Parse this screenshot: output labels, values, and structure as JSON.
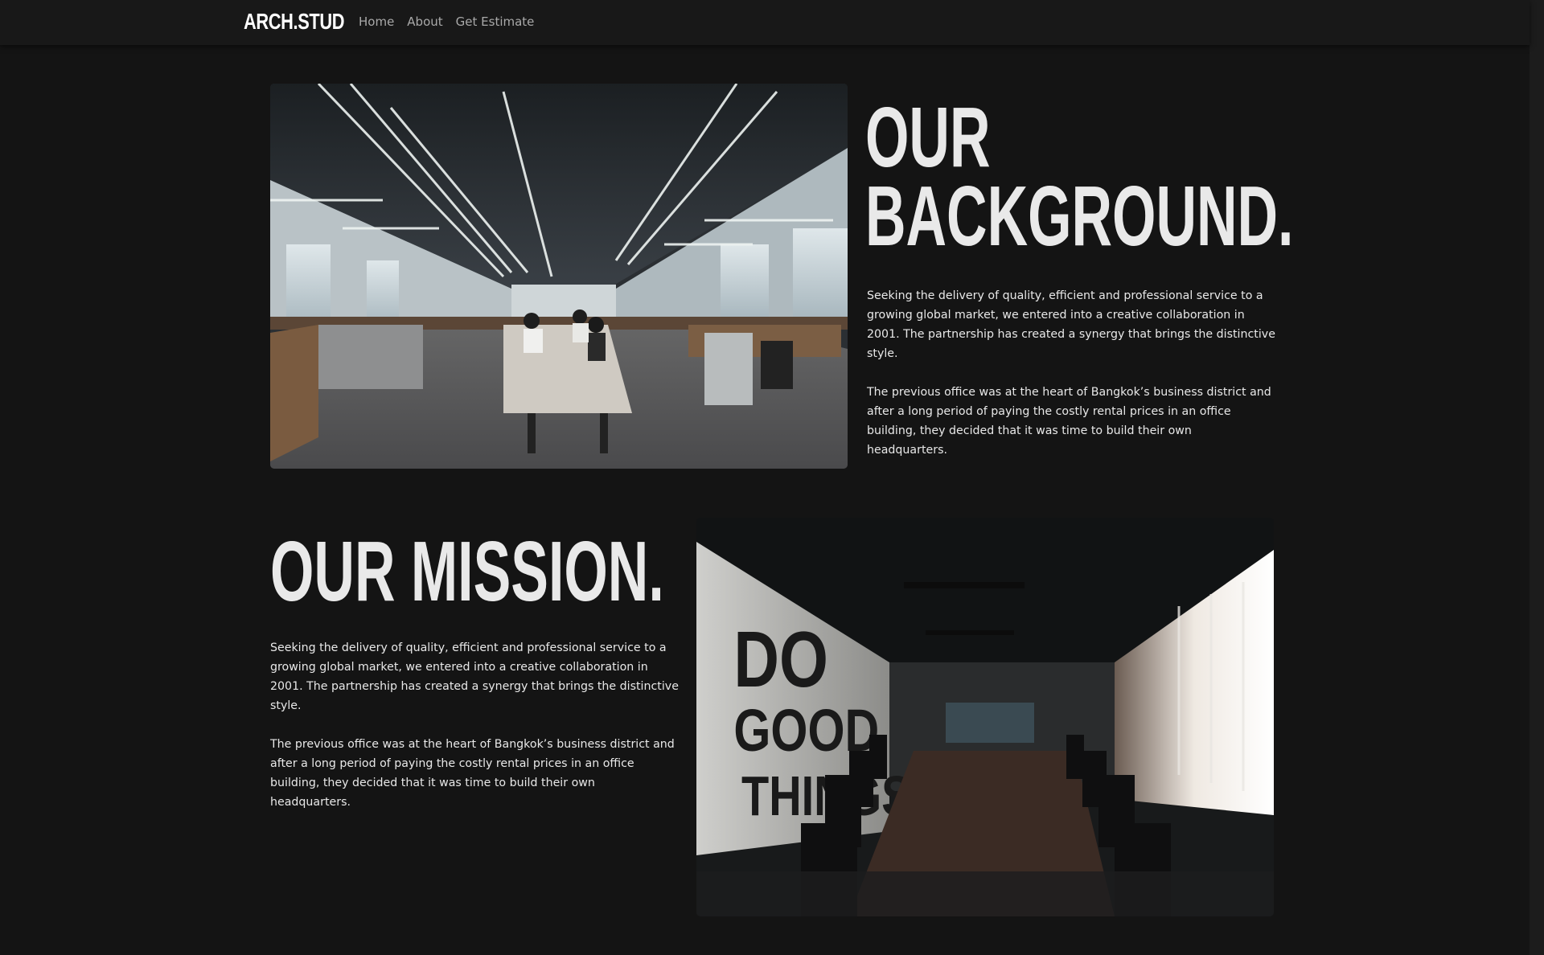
{
  "nav": {
    "brand": "ARCH.STUD",
    "links": [
      "Home",
      "About",
      "Get Estimate"
    ]
  },
  "sections": {
    "background": {
      "heading_line1": "OUR",
      "heading_line2": "BACKGROUND.",
      "paragraphs": [
        "Seeking the delivery of quality, efficient and professional service to a\ngrowing global market, we entered into a creative collaboration in\n2001. The partnership has created a synergy that brings the distinctive\nstyle.",
        "The previous office was at the heart of Bangkok’s business district and\nafter a long period of paying the costly rental prices in an office\nbuilding, they decided that it was time to build their own\nheadquarters."
      ]
    },
    "mission": {
      "heading": "OUR MISSION.",
      "paragraphs": [
        "Seeking the delivery of quality, efficient and professional service to a\ngrowing global market, we entered into a creative collaboration in\n2001. The partnership has created a synergy that brings the distinctive\nstyle.",
        "The previous office was at the heart of Bangkok’s business district and\nafter a long period of paying the costly rental prices in an office\nbuilding, they decided that it was time to build their own\nheadquarters."
      ]
    },
    "conference_wall_text": [
      "DO",
      "GOOD",
      "THINGS"
    ]
  },
  "colors": {
    "page_bg": "#141414",
    "navbar_bg": "#181818",
    "heading": "#e9e9e9",
    "body_text": "#e8e8e8",
    "nav_link": "#a9a9a9"
  }
}
